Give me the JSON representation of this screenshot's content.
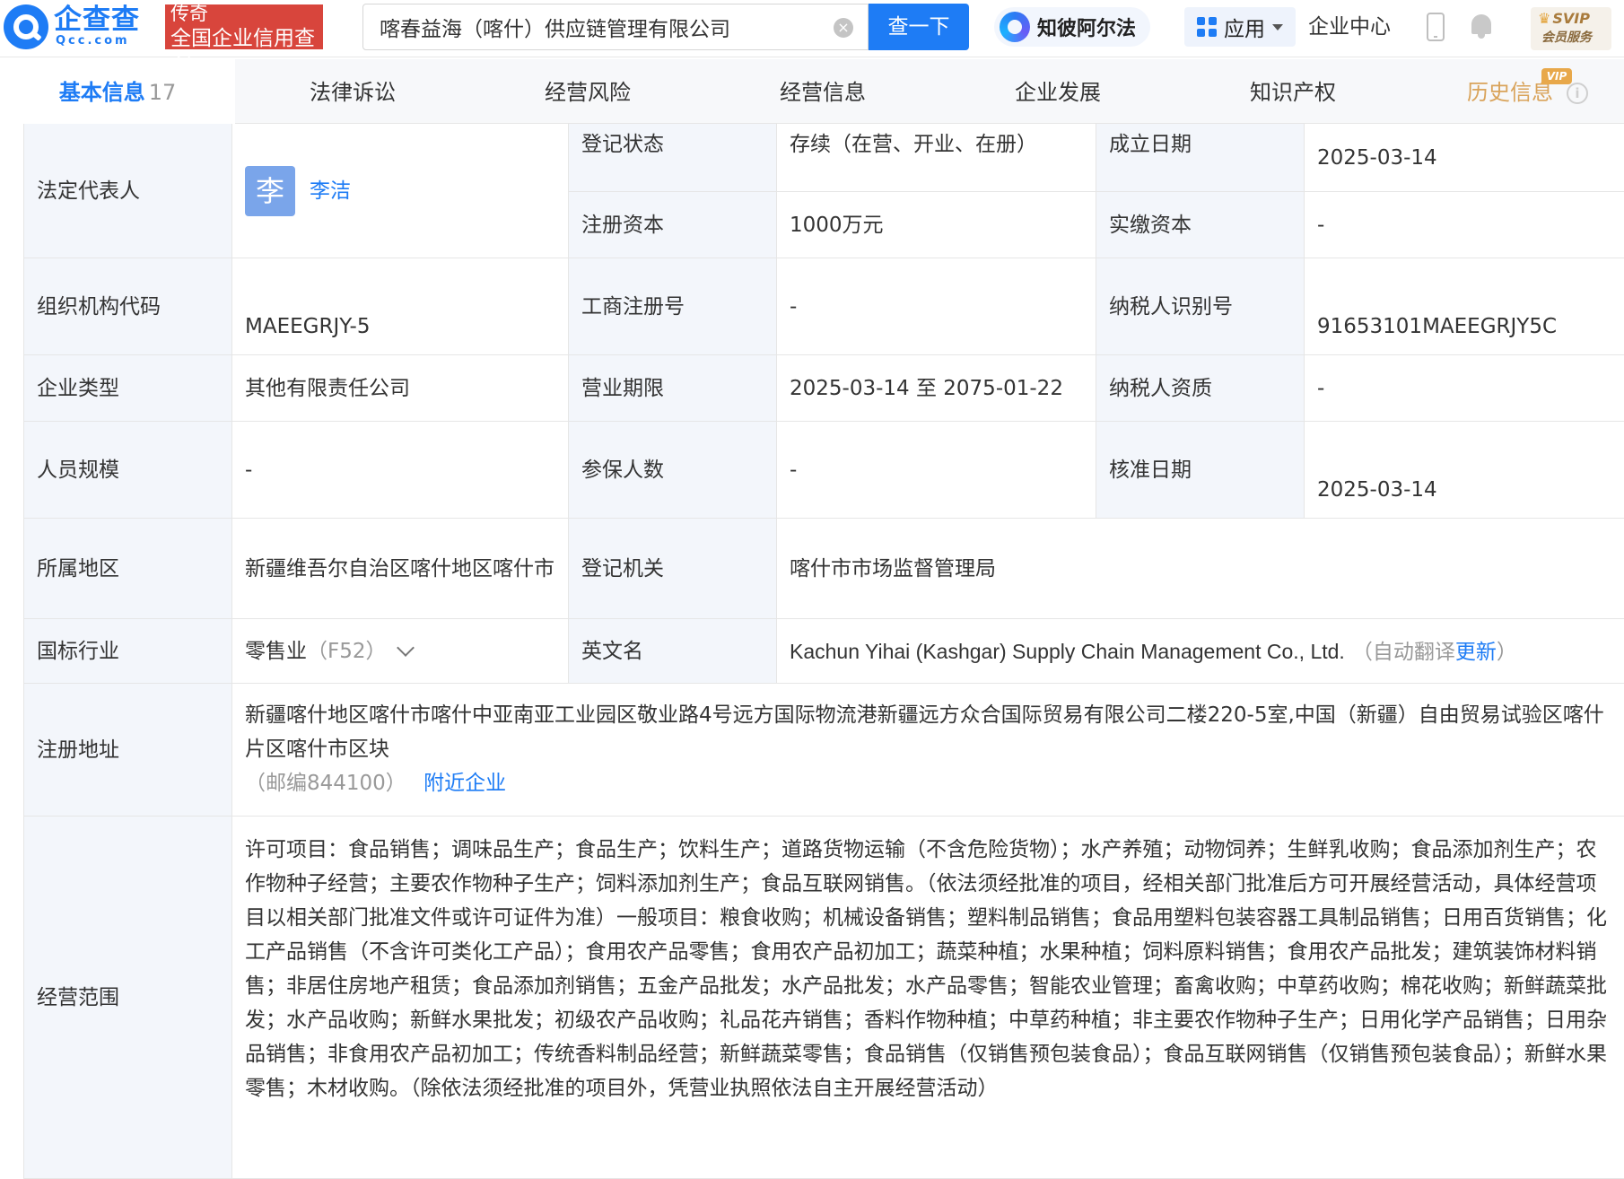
{
  "header": {
    "logo": {
      "cn": "企查查",
      "en": "Qcc.com",
      "badge_line1": "传奇",
      "badge_line2": "全国企业信用查询"
    },
    "search": {
      "value": "喀春益海（喀什）供应链管理有限公司",
      "button": "查一下"
    },
    "alpha": "知彼阿尔法",
    "apps": "应用",
    "enterprise_center": "企业中心",
    "svip": {
      "top": "SVIP",
      "sub": "会员服务"
    }
  },
  "tabs": [
    {
      "label": "基本信息",
      "count": "17"
    },
    {
      "label": "法律诉讼"
    },
    {
      "label": "经营风险"
    },
    {
      "label": "经营信息"
    },
    {
      "label": "企业发展"
    },
    {
      "label": "知识产权"
    },
    {
      "label": "历史信息",
      "tag": "VIP"
    }
  ],
  "info": {
    "legal_rep": {
      "label": "法定代表人",
      "avatar": "李",
      "name": "李洁"
    },
    "reg_status": {
      "label": "登记状态",
      "value": "存续（在营、开业、在册）"
    },
    "founded": {
      "label": "成立日期",
      "value": "2025-03-14"
    },
    "reg_capital": {
      "label": "注册资本",
      "value": "1000万元"
    },
    "paid_capital": {
      "label": "实缴资本",
      "value": "-"
    },
    "org_code": {
      "label": "组织机构代码",
      "value": "MAEEGRJY-5"
    },
    "biz_reg_no": {
      "label": "工商注册号",
      "value": "-"
    },
    "taxpayer_id": {
      "label": "纳税人识别号",
      "value": "91653101MAEEGRJY5C"
    },
    "company_type": {
      "label": "企业类型",
      "value": "其他有限责任公司"
    },
    "term": {
      "label": "营业期限",
      "value": "2025-03-14 至 2075-01-22"
    },
    "taxpayer_qual": {
      "label": "纳税人资质",
      "value": "-"
    },
    "staff_size": {
      "label": "人员规模",
      "value": "-"
    },
    "insured": {
      "label": "参保人数",
      "value": "-"
    },
    "approved": {
      "label": "核准日期",
      "value": "2025-03-14"
    },
    "region": {
      "label": "所属地区",
      "value": "新疆维吾尔自治区喀什地区喀什市"
    },
    "authority": {
      "label": "登记机关",
      "value": "喀什市市场监督管理局"
    },
    "industry": {
      "label": "国标行业",
      "value": "零售业",
      "code": "（F52）"
    },
    "english_name": {
      "label": "英文名",
      "value": "Kachun Yihai (Kashgar) Supply Chain Management Co., Ltd.",
      "note_prefix": "（自动翻译",
      "note_link": "更新",
      "note_suffix": "）"
    },
    "address": {
      "label": "注册地址",
      "value": "新疆喀什地区喀什市喀什中亚南亚工业园区敬业路4号远方国际物流港新疆远方众合国际贸易有限公司二楼220-5室,中国（新疆）自由贸易试验区喀什片区喀什市区块",
      "postcode": "（邮编844100）",
      "nearby": "附近企业"
    },
    "scope": {
      "label": "经营范围",
      "value": "许可项目：食品销售；调味品生产；食品生产；饮料生产；道路货物运输（不含危险货物）；水产养殖；动物饲养；生鲜乳收购；食品添加剂生产；农作物种子经营；主要农作物种子生产；饲料添加剂生产；食品互联网销售。（依法须经批准的项目，经相关部门批准后方可开展经营活动，具体经营项目以相关部门批准文件或许可证件为准）一般项目：粮食收购；机械设备销售；塑料制品销售；食品用塑料包装容器工具制品销售；日用百货销售；化工产品销售（不含许可类化工产品）；食用农产品零售；食用农产品初加工；蔬菜种植；水果种植；饲料原料销售；食用农产品批发；建筑装饰材料销售；非居住房地产租赁；食品添加剂销售；五金产品批发；水产品批发；水产品零售；智能农业管理；畜禽收购；中草药收购；棉花收购；新鲜蔬菜批发；水产品收购；新鲜水果批发；初级农产品收购；礼品花卉销售；香料作物种植；中草药种植；非主要农作物种子生产；日用化学产品销售；日用杂品销售；非食用农产品初加工；传统香料制品经营；新鲜蔬菜零售；食品销售（仅销售预包装食品）；食品互联网销售（仅销售预包装食品）；新鲜水果零售；木材收购。（除依法须经批准的项目外，凭营业执照依法自主开展经营活动）"
    }
  },
  "colors": {
    "accent": "#1e7cf5",
    "brand_red": "#d8453c",
    "label_bg": "#f3f6fb",
    "vip_gold": "#d9a35a"
  }
}
